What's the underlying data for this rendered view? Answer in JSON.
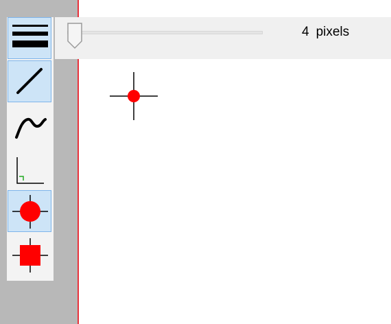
{
  "toolbox": {
    "tools": [
      {
        "name": "line-width-tool",
        "icon": "line-width-icon",
        "active": true
      },
      {
        "name": "straight-line-tool",
        "icon": "straight-line-icon",
        "active": true
      },
      {
        "name": "curve-tool",
        "icon": "curve-icon",
        "active": false
      },
      {
        "name": "right-angle-tool",
        "icon": "right-angle-icon",
        "active": false
      },
      {
        "name": "circle-point-tool",
        "icon": "red-circle-crosshair-icon",
        "active": true
      },
      {
        "name": "square-point-tool",
        "icon": "red-square-crosshair-icon",
        "active": false
      }
    ]
  },
  "options": {
    "width_value": "4",
    "width_unit": "pixels",
    "slider_fraction": 0.0
  },
  "canvas": {
    "cursor_icon": "red-dot-crosshair-icon"
  },
  "colors": {
    "accent_red": "#e8313b",
    "marker_red": "#ff0000",
    "active_tool_bg": "#cde4f7",
    "active_tool_border": "#7eb4ea",
    "sidebar_gray": "#b8b8b8",
    "corner_green": "#22aa22"
  }
}
